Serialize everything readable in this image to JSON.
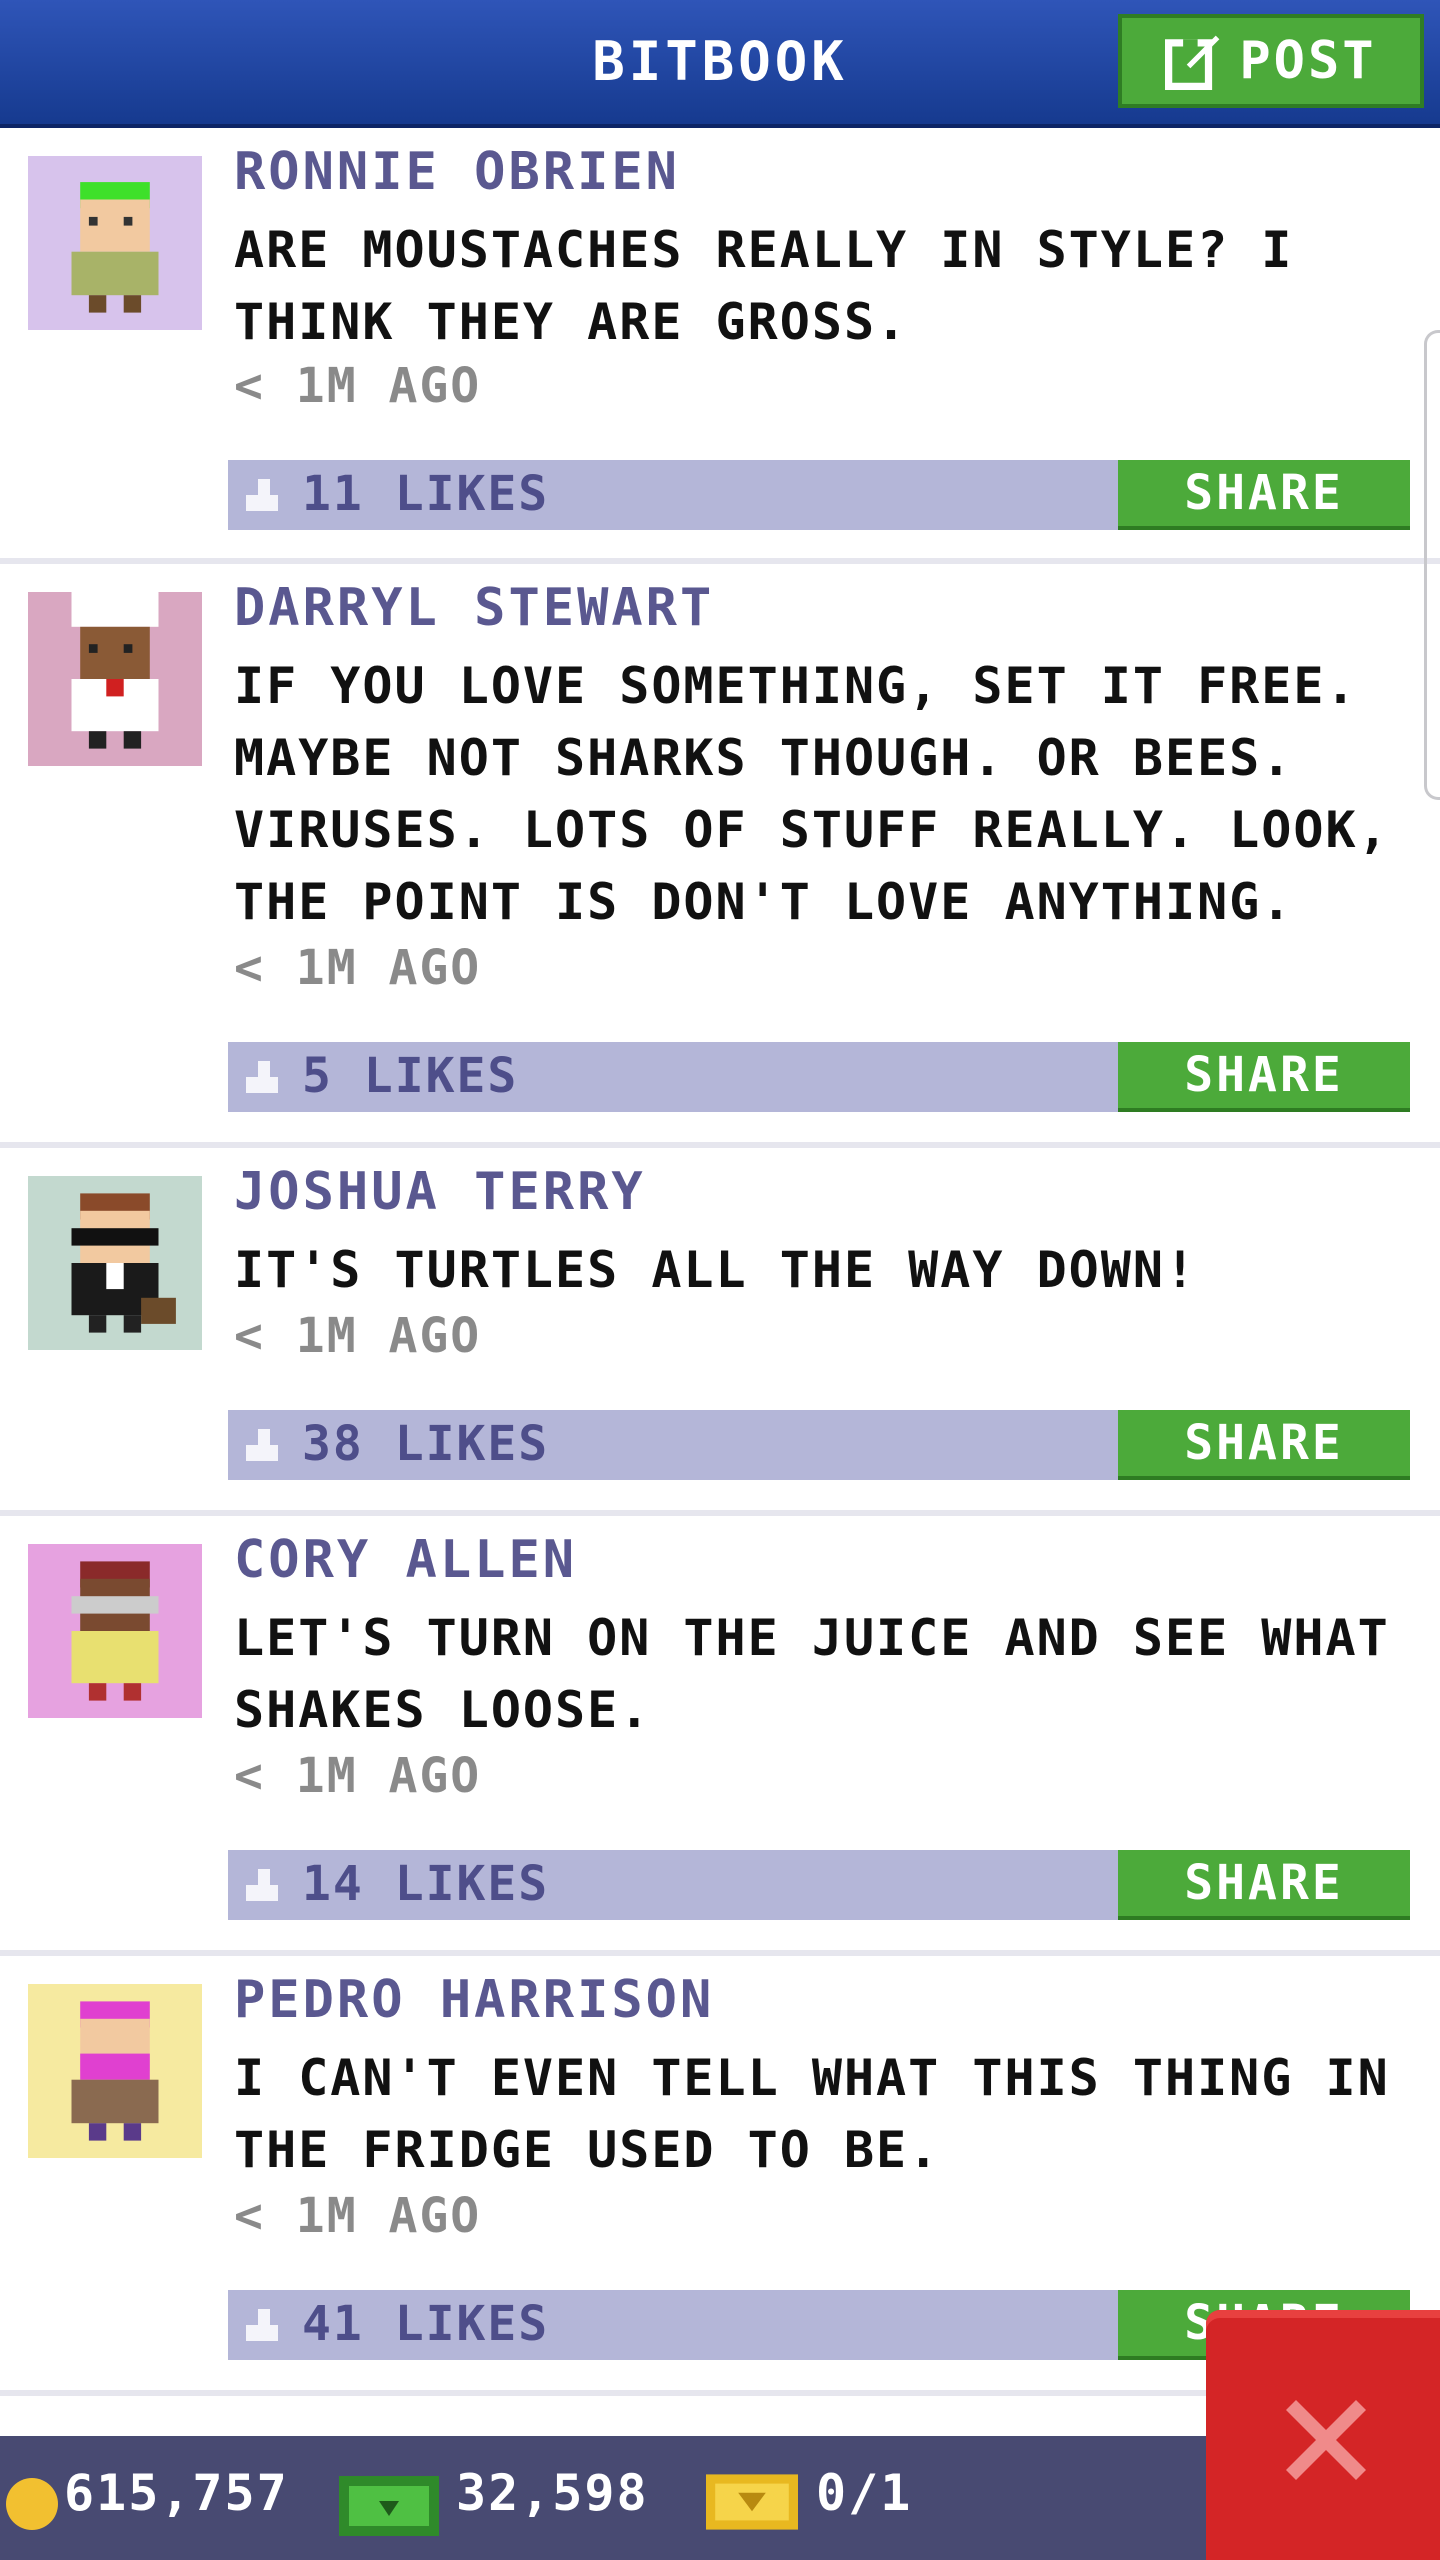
{
  "header": {
    "title": "BITBOOK",
    "post_label": "POST"
  },
  "posts": [
    {
      "author": "RONNIE OBRIEN",
      "message": "ARE MOUSTACHES REALLY IN STYLE? I THINK THEY ARE GROSS.",
      "time": "< 1M AGO",
      "likes": "11 LIKES",
      "share_label": "SHARE",
      "avatar_bg": "#d7c3ec"
    },
    {
      "author": "DARRYL STEWART",
      "message": "IF YOU LOVE SOMETHING, SET IT FREE. MAYBE NOT SHARKS THOUGH. OR BEES. VIRUSES. LOTS OF STUFF REALLY. LOOK, THE POINT IS DON'T LOVE ANYTHING.",
      "time": "< 1M AGO",
      "likes": "5 LIKES",
      "share_label": "SHARE",
      "avatar_bg": "#d9a7c1"
    },
    {
      "author": "JOSHUA TERRY",
      "message": "IT'S TURTLES ALL THE WAY DOWN!",
      "time": "< 1M AGO",
      "likes": "38 LIKES",
      "share_label": "SHARE",
      "avatar_bg": "#c3d9cf"
    },
    {
      "author": "CORY ALLEN",
      "message": "LET'S TURN ON THE JUICE AND SEE WHAT SHAKES LOOSE.",
      "time": "< 1M AGO",
      "likes": "14 LIKES",
      "share_label": "SHARE",
      "avatar_bg": "#e6a2e0"
    },
    {
      "author": "PEDRO HARRISON",
      "message": "I CAN'T EVEN TELL WHAT THIS THING IN THE FRIDGE USED TO BE.",
      "time": "< 1M AGO",
      "likes": "41 LIKES",
      "share_label": "SHARE",
      "avatar_bg": "#f6eaa0"
    }
  ],
  "footer": {
    "coins": "615,757",
    "bux": "32,598",
    "tickets": "0/1"
  },
  "colors": {
    "header": "#1f47a8",
    "share_green": "#4caa3a",
    "like_bar": "#b4b6d8",
    "close_red": "#d42526"
  }
}
